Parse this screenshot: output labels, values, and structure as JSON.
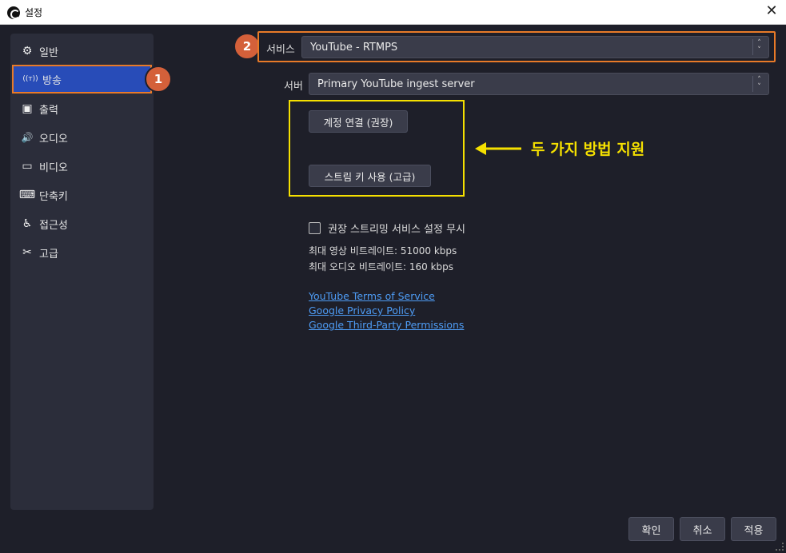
{
  "window": {
    "title": "설정",
    "close_glyph": "✕"
  },
  "sidebar": {
    "items": [
      {
        "label": "일반",
        "icon": "gear-icon",
        "glyph": "⚙"
      },
      {
        "label": "방송",
        "icon": "broadcast-icon",
        "glyph": "((ᴛ))"
      },
      {
        "label": "출력",
        "icon": "output-icon",
        "glyph": "▣"
      },
      {
        "label": "오디오",
        "icon": "speaker-icon",
        "glyph": "🔊"
      },
      {
        "label": "비디오",
        "icon": "monitor-icon",
        "glyph": "▭"
      },
      {
        "label": "단축키",
        "icon": "keyboard-icon",
        "glyph": "⌨"
      },
      {
        "label": "접근성",
        "icon": "accessibility-icon",
        "glyph": "♿"
      },
      {
        "label": "고급",
        "icon": "tools-icon",
        "glyph": "✂"
      }
    ],
    "active_index": 1
  },
  "annotations": {
    "badge1": "1",
    "badge2": "2",
    "callout": "두 가지 방법 지원"
  },
  "stream": {
    "service_label": "서비스",
    "service_value": "YouTube - RTMPS",
    "server_label": "서버",
    "server_value": "Primary YouTube ingest server",
    "connect_button": "계정 연결 (권장)",
    "stream_key_button": "스트림 키 사용 (고급)",
    "ignore_label": "권장 스트리밍 서비스 설정 무시",
    "max_video_bitrate": "최대 영상 비트레이트: 51000 kbps",
    "max_audio_bitrate": "최대 오디오 비트레이트: 160 kbps",
    "links": [
      "YouTube Terms of Service",
      "Google Privacy Policy",
      "Google Third-Party Permissions"
    ]
  },
  "footer": {
    "ok": "확인",
    "cancel": "취소",
    "apply": "적용"
  },
  "colors": {
    "accent": "#284cb8",
    "highlight_orange": "#e87a28",
    "highlight_yellow": "#f5e000",
    "badge": "#d4603a",
    "link": "#4e9cf5"
  }
}
